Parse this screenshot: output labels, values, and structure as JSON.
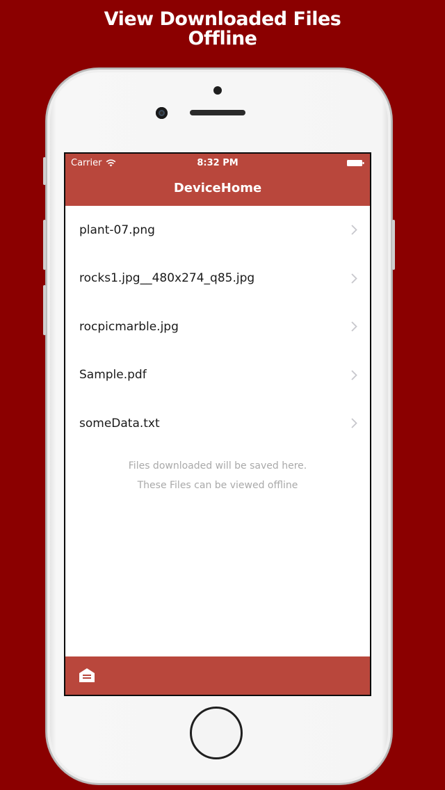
{
  "promo": {
    "title_line1": "View Downloaded Files",
    "title_line2": "Offline"
  },
  "status_bar": {
    "carrier": "Carrier",
    "time": "8:32 PM",
    "icons": [
      "wifi-icon",
      "battery-icon"
    ]
  },
  "nav": {
    "title": "DeviceHome"
  },
  "files": [
    {
      "name": "plant-07.png"
    },
    {
      "name": "rocks1.jpg__480x274_q85.jpg"
    },
    {
      "name": "rocpicmarble.jpg"
    },
    {
      "name": "Sample.pdf"
    },
    {
      "name": "someData.txt"
    }
  ],
  "footer": {
    "line1": "Files downloaded will be saved here.",
    "line2": "These Files can be viewed offline"
  },
  "tabbar": {
    "icon": "home-icon"
  },
  "colors": {
    "background": "#8b0000",
    "accent": "#b9473c",
    "text": "#1a1a1a",
    "muted": "#a9a9a9"
  }
}
